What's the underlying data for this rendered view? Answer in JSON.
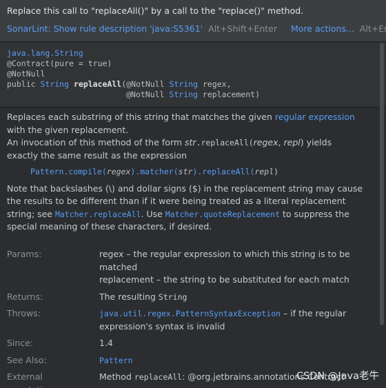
{
  "header": {
    "problem": "Replace this call to \"replaceAll()\" by a call to the \"replace()\" method.",
    "rule_link": "SonarLint: Show rule description 'java:S5361'",
    "rule_shortcut": "Alt+Shift+Enter",
    "more_actions": "More actions...",
    "more_shortcut": "Alt+Enter"
  },
  "signature": {
    "class_name": "java.lang.String",
    "contract": "@Contract(pure = true)",
    "notnull": "@NotNull",
    "public": "public",
    "return_type": "String",
    "method": "replaceAll",
    "param1_ann": "(@NotNull",
    "param1_type": "String",
    "param1_name": "regex,",
    "param2_ann": "@NotNull",
    "param2_type": "String",
    "param2_name": "replacement)"
  },
  "description": {
    "p1_a": "Replaces each substring of this string that matches the given ",
    "p1_link": "regular expression",
    "p1_b": " with the given replacement.",
    "p2_a": "An invocation of this method of the form ",
    "p2_str": "str",
    "p2_code1": ".replaceAll(",
    "p2_regex": "regex",
    "p2_comma": ", ",
    "p2_repl": "repl",
    "p2_close": ")",
    "p2_b": " yields exactly the same result as the expression",
    "code_pattern": "Pattern",
    "code_compile": ".compile(",
    "code_regex": "regex",
    "code_matcher": ").matcher(",
    "code_str": "str",
    "code_replaceall": ").replaceAll(",
    "code_repl": "repl",
    "code_end": ")",
    "p3_a": "Note that backslashes (\\) and dollar signs ($) in the replacement string may cause the results to be different than if it were being treated as a literal replacement string; see ",
    "p3_link1": "Matcher.replaceAll",
    "p3_b": ". Use ",
    "p3_link2": "Matcher.quoteReplacement",
    "p3_c": " to suppress the special meaning of these characters, if desired."
  },
  "params": {
    "params_label": "Params:",
    "param_regex": "regex – the regular expression to which this string is to be matched",
    "param_replacement": "replacement – the string to be substituted for each match",
    "returns_label": "Returns:",
    "returns_text": "The resulting ",
    "returns_code": "String",
    "throws_label": "Throws:",
    "throws_link": "java.util.regex.PatternSyntaxException",
    "throws_text": " – if the regular expression's syntax is invalid",
    "since_label": "Since:",
    "since_value": "1.4",
    "see_label": "See Also:",
    "see_link": "Pattern",
    "ext_label": "External annotations:",
    "ext_text": "Method ",
    "ext_code": "replaceAll",
    "ext_rest": ": @org.jetbrains.annotations.Contract"
  },
  "watermark": "CSDN @Java老牛"
}
